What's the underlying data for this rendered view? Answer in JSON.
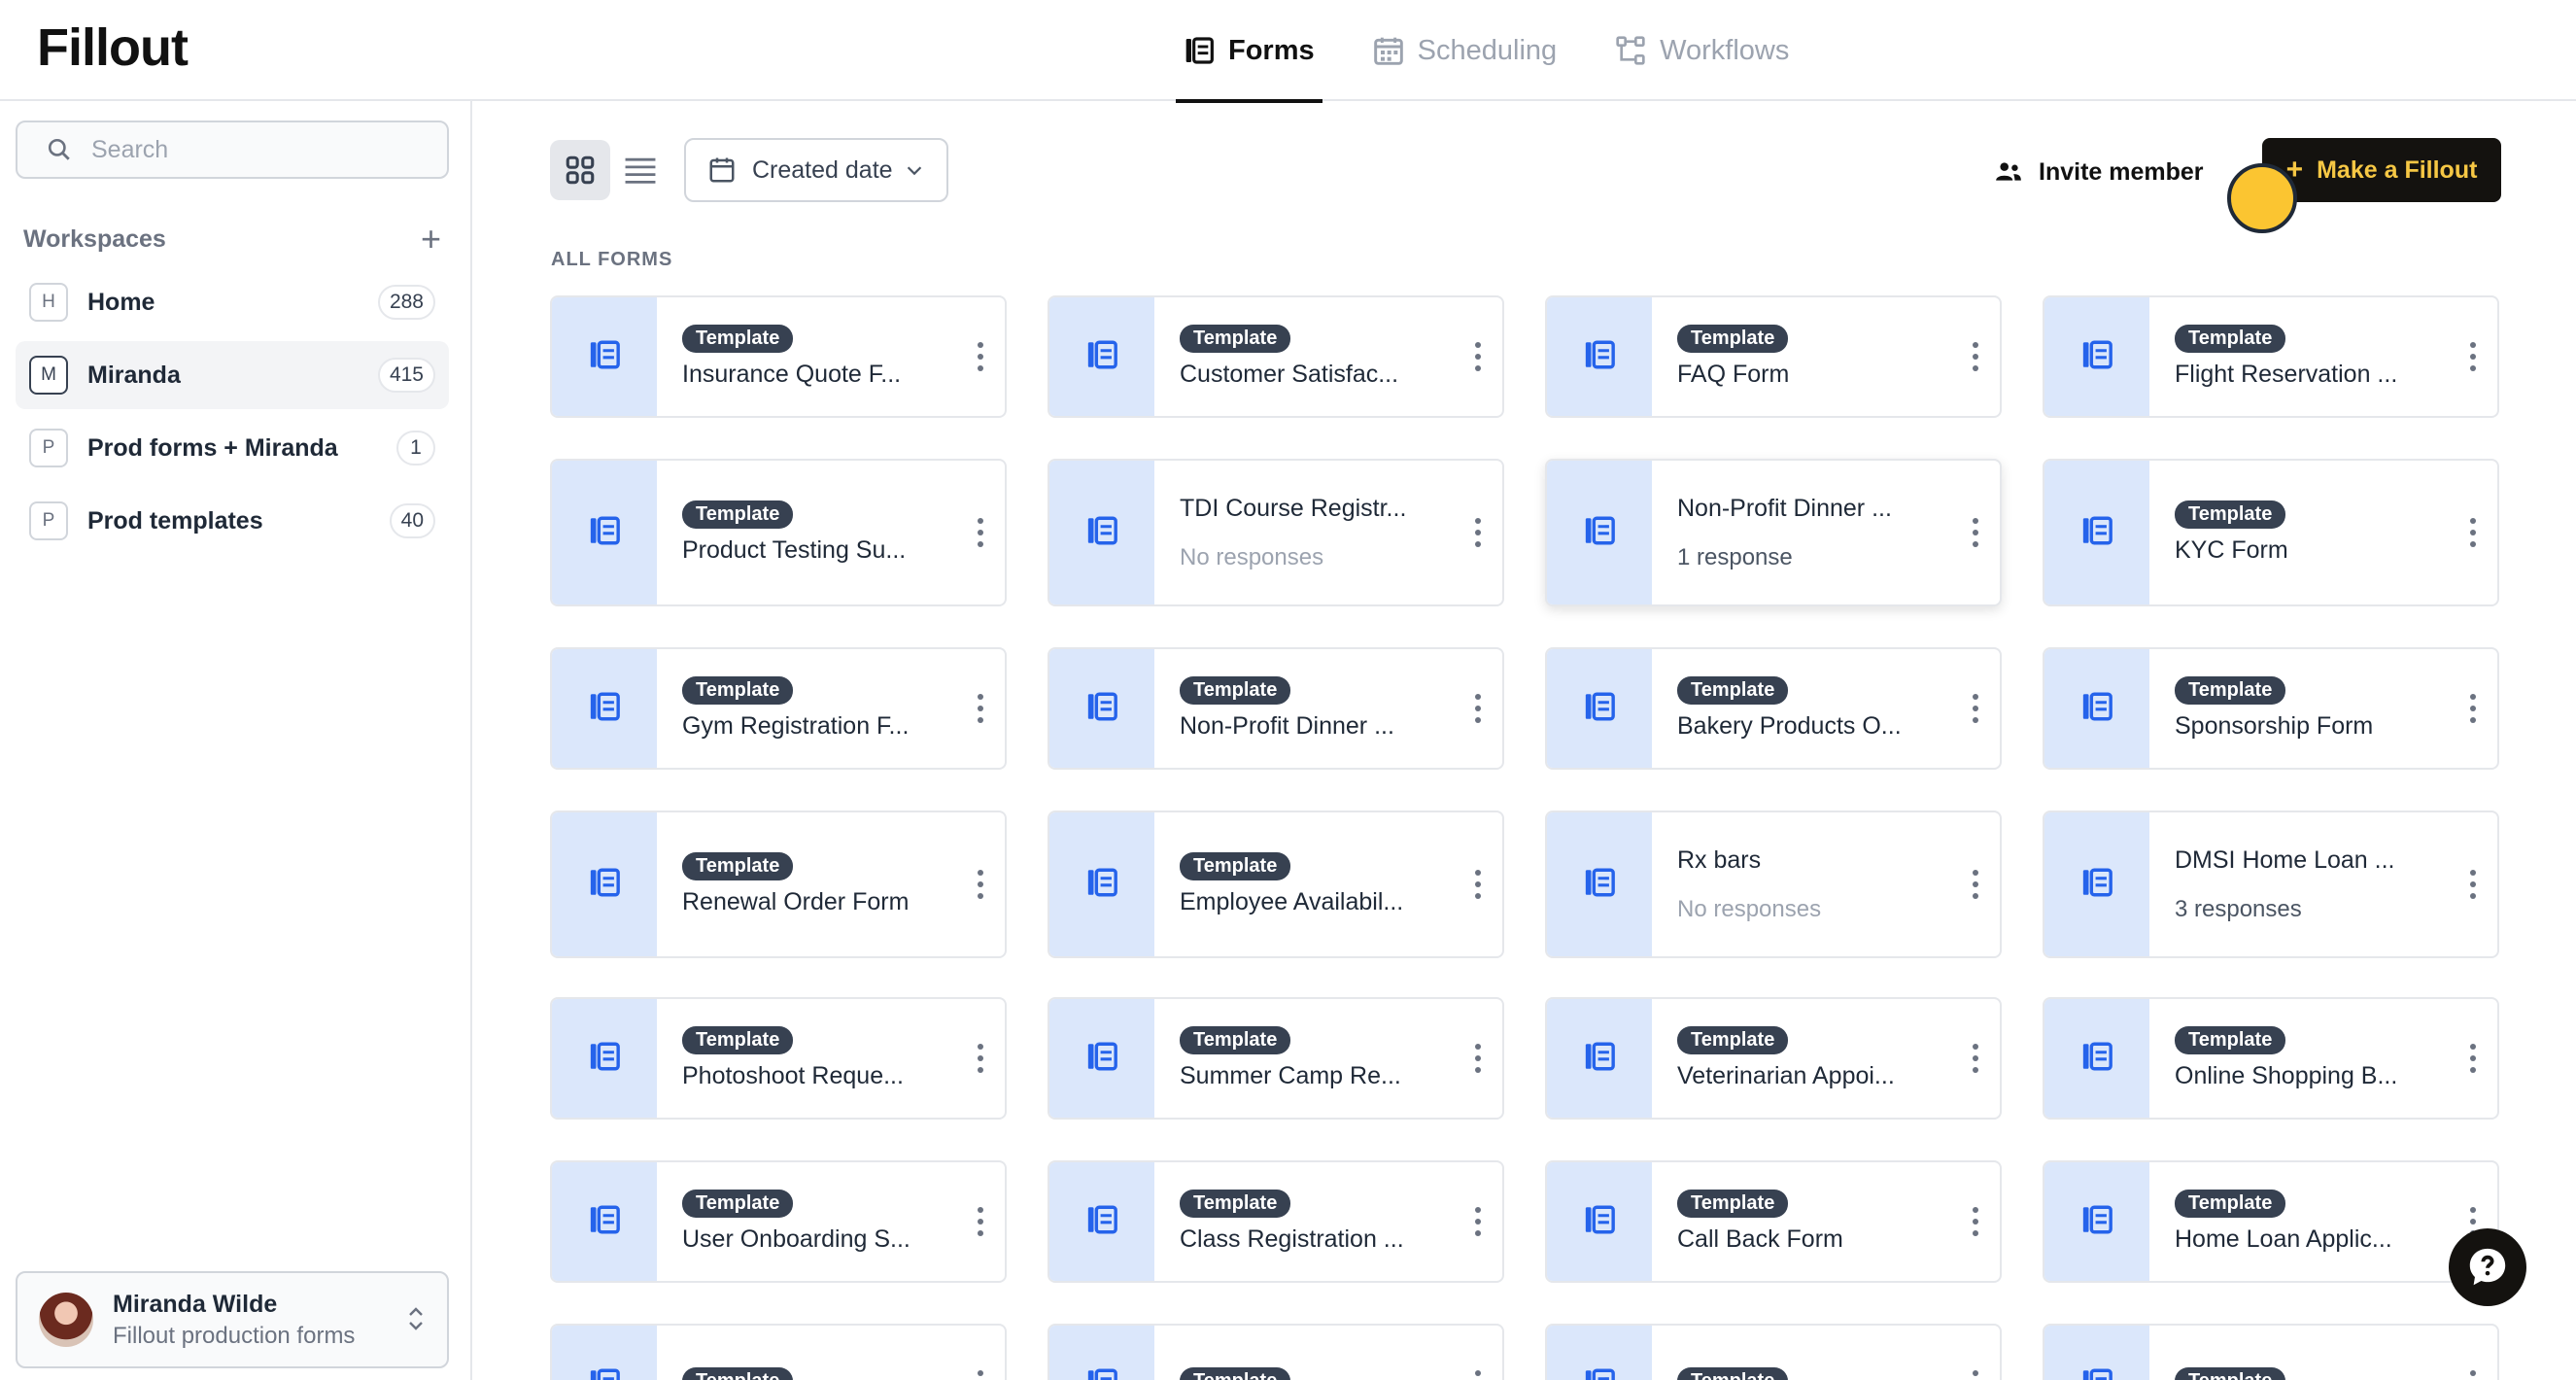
{
  "app": {
    "logo": "Fillout"
  },
  "tabs": [
    {
      "label": "Forms",
      "icon": "forms-icon",
      "active": true
    },
    {
      "label": "Scheduling",
      "icon": "calendar-icon",
      "active": false
    },
    {
      "label": "Workflows",
      "icon": "workflow-icon",
      "active": false
    }
  ],
  "sidebar": {
    "search_placeholder": "Search",
    "workspaces_title": "Workspaces",
    "items": [
      {
        "letter": "H",
        "name": "Home",
        "count": "288",
        "active": false
      },
      {
        "letter": "M",
        "name": "Miranda",
        "count": "415",
        "active": true
      },
      {
        "letter": "P",
        "name": "Prod forms + Miranda",
        "count": "1",
        "active": false
      },
      {
        "letter": "P",
        "name": "Prod templates",
        "count": "40",
        "active": false
      }
    ],
    "user": {
      "name": "Miranda Wilde",
      "org": "Fillout production forms"
    }
  },
  "toolbar": {
    "sort_label": "Created date",
    "invite_label": "Invite member",
    "make_label": "Make a Fillout"
  },
  "section_title": "ALL FORMS",
  "badge_label": "Template",
  "forms": [
    [
      {
        "badge": true,
        "title": "Insurance Quote F...",
        "sub": ""
      },
      {
        "badge": true,
        "title": "Customer Satisfac...",
        "sub": ""
      },
      {
        "badge": true,
        "title": "FAQ Form",
        "sub": ""
      },
      {
        "badge": true,
        "title": "Flight Reservation ...",
        "sub": ""
      }
    ],
    [
      {
        "badge": true,
        "title": "Product Testing Su...",
        "sub": ""
      },
      {
        "badge": false,
        "title": "TDI Course Registr...",
        "sub": "No responses"
      },
      {
        "badge": false,
        "title": "Non-Profit Dinner ...",
        "sub": "1 response"
      },
      {
        "badge": true,
        "title": "KYC Form",
        "sub": ""
      }
    ],
    [
      {
        "badge": true,
        "title": "Gym Registration F...",
        "sub": ""
      },
      {
        "badge": true,
        "title": "Non-Profit Dinner ...",
        "sub": ""
      },
      {
        "badge": true,
        "title": "Bakery Products O...",
        "sub": ""
      },
      {
        "badge": true,
        "title": "Sponsorship Form",
        "sub": ""
      }
    ],
    [
      {
        "badge": true,
        "title": "Renewal Order Form",
        "sub": ""
      },
      {
        "badge": true,
        "title": "Employee Availabil...",
        "sub": ""
      },
      {
        "badge": false,
        "title": "Rx bars",
        "sub": "No responses"
      },
      {
        "badge": false,
        "title": "DMSI Home Loan ...",
        "sub": "3 responses"
      }
    ],
    [
      {
        "badge": true,
        "title": "Photoshoot Reque...",
        "sub": ""
      },
      {
        "badge": true,
        "title": "Summer Camp Re...",
        "sub": ""
      },
      {
        "badge": true,
        "title": "Veterinarian Appoi...",
        "sub": ""
      },
      {
        "badge": true,
        "title": "Online Shopping B...",
        "sub": ""
      }
    ],
    [
      {
        "badge": true,
        "title": "User Onboarding S...",
        "sub": ""
      },
      {
        "badge": true,
        "title": "Class Registration ...",
        "sub": ""
      },
      {
        "badge": true,
        "title": "Call Back Form",
        "sub": ""
      },
      {
        "badge": true,
        "title": "Home Loan Applic...",
        "sub": ""
      }
    ],
    [
      {
        "badge": true,
        "title": "",
        "sub": ""
      },
      {
        "badge": true,
        "title": "",
        "sub": ""
      },
      {
        "badge": true,
        "title": "",
        "sub": ""
      },
      {
        "badge": true,
        "title": "",
        "sub": ""
      }
    ]
  ]
}
